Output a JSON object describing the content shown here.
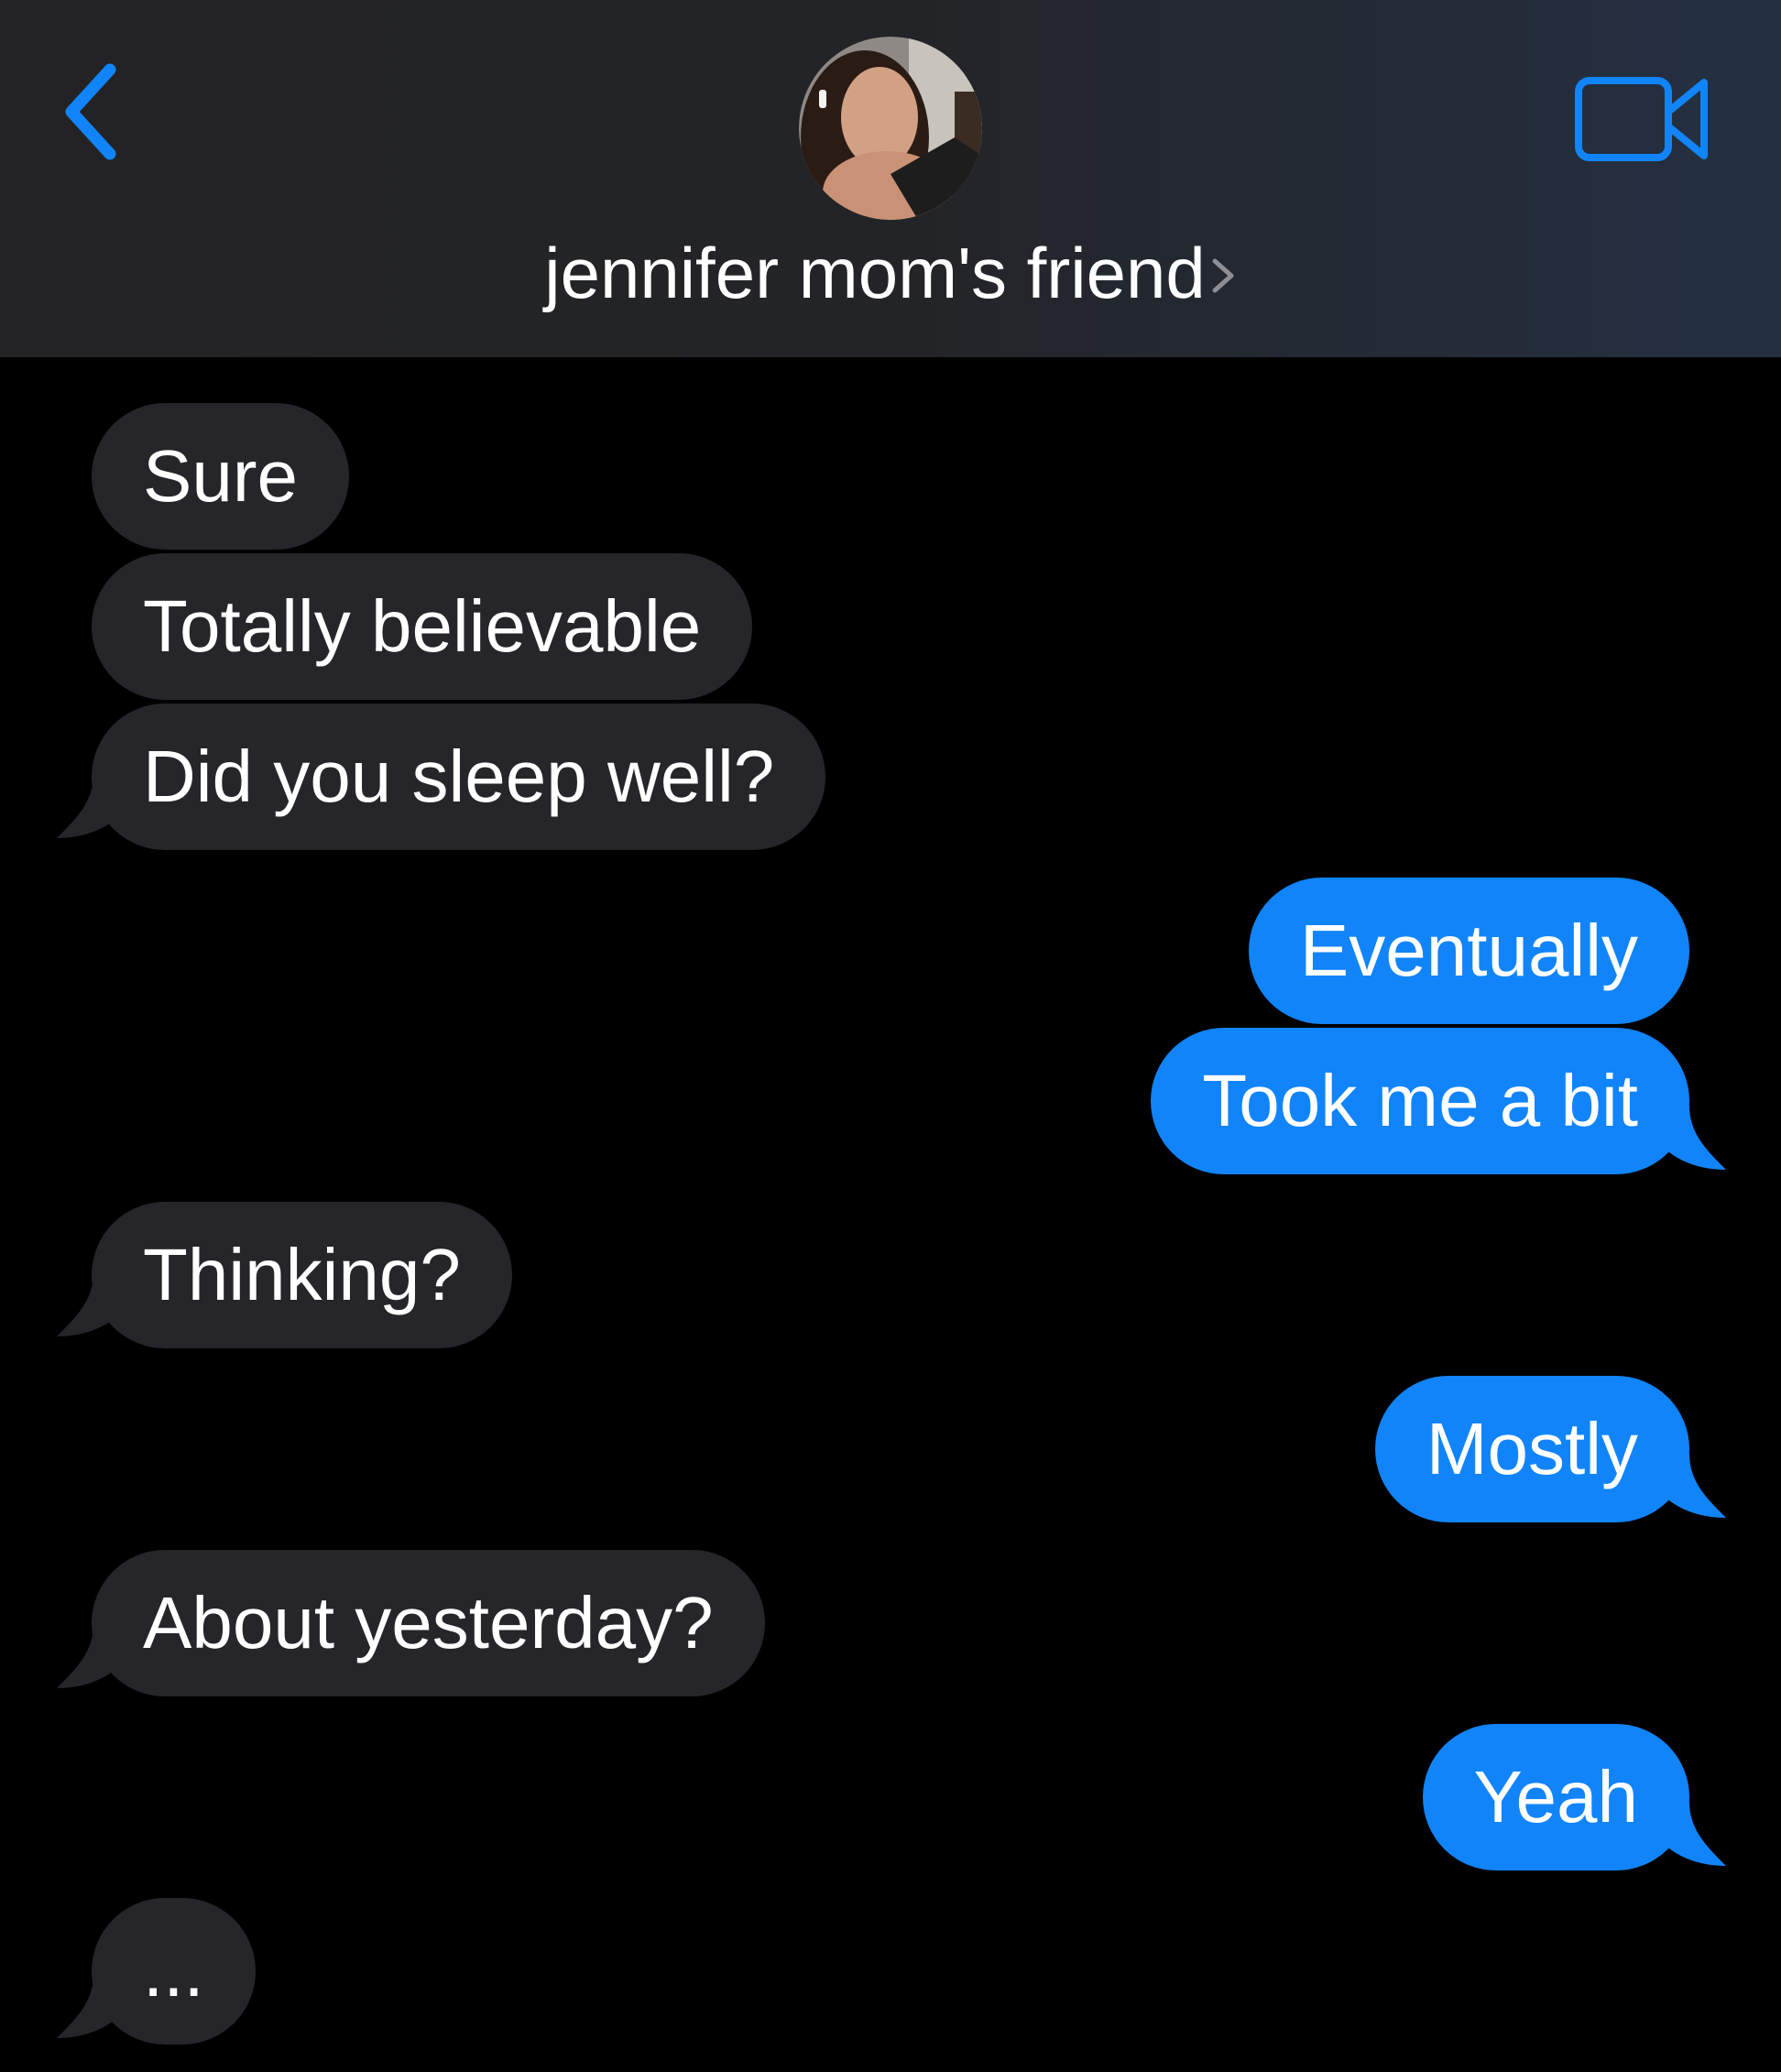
{
  "header": {
    "contact_name": "jennifer mom's friend",
    "back_icon": "chevron-left-icon",
    "video_icon": "video-camera-icon",
    "accent_color": "#1184fa"
  },
  "colors": {
    "received_bubble": "#26252a",
    "sent_bubble": "#1184fa",
    "background": "#000000"
  },
  "messages": [
    {
      "from": "them",
      "text": "Sure"
    },
    {
      "from": "them",
      "text": "Totally believable"
    },
    {
      "from": "them",
      "text": "Did you sleep well?"
    },
    {
      "from": "me",
      "text": "Eventually"
    },
    {
      "from": "me",
      "text": "Took me a bit"
    },
    {
      "from": "them",
      "text": "Thinking?"
    },
    {
      "from": "me",
      "text": "Mostly"
    },
    {
      "from": "them",
      "text": "About yesterday?"
    },
    {
      "from": "me",
      "text": "Yeah"
    },
    {
      "from": "them",
      "text": "..."
    }
  ]
}
